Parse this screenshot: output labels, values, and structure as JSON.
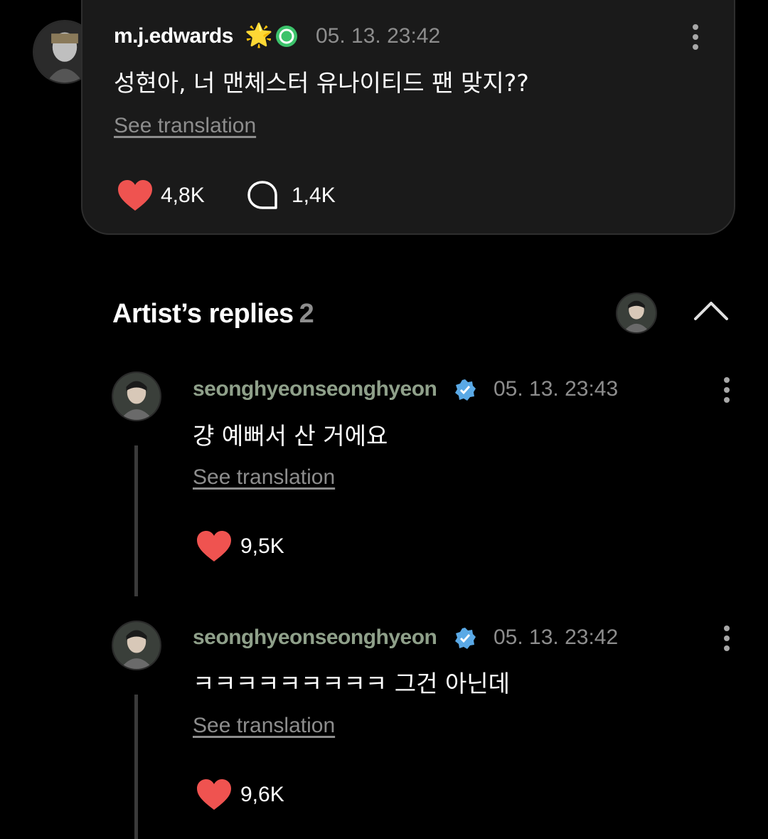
{
  "post": {
    "username": "m.j.edwards",
    "badge_emoji": "🌟",
    "timestamp": "05. 13. 23:42",
    "text": "성현아, 너 맨체스터 유나이티드 팬 맞지??",
    "see_translation": "See translation",
    "likes": "4,8K",
    "comments": "1,4K"
  },
  "artist_replies": {
    "title": "Artist’s replies",
    "count": "2"
  },
  "replies": [
    {
      "username": "seonghyeonseonghyeon",
      "timestamp": "05. 13. 23:43",
      "text": "걍 예뻐서 산 거에요",
      "see_translation": "See translation",
      "likes": "9,5K"
    },
    {
      "username": "seonghyeonseonghyeon",
      "timestamp": "05. 13. 23:42",
      "text": "ㅋㅋㅋㅋㅋㅋㅋㅋㅋ 그건 아닌데",
      "see_translation": "See translation",
      "likes": "9,6K"
    }
  ],
  "colors": {
    "background": "#000000",
    "card": "#1a1a1a",
    "heart": "#ef5350",
    "verified_green": "#3cc36b",
    "verified_blue": "#5aa9e6",
    "muted_text": "#8d8d8d"
  },
  "icons": [
    "heart-icon",
    "comment-icon",
    "more-icon",
    "verified-icon",
    "chevron-up-icon"
  ]
}
